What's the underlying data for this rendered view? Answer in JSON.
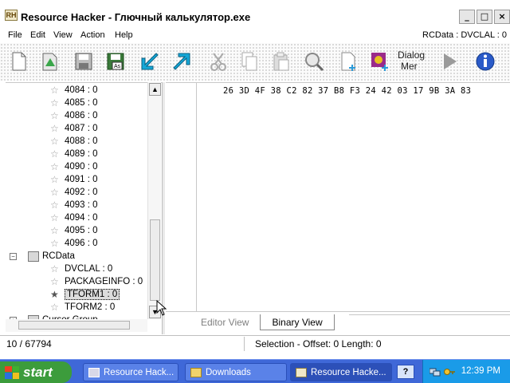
{
  "window": {
    "icon_text": "RH",
    "title": "Resource Hacker - Глючный калькулятор.exe",
    "buttons": {
      "minimize": "_",
      "maximize": "□",
      "close": "×"
    }
  },
  "menu": {
    "items": [
      "File",
      "Edit",
      "View",
      "Action",
      "Help"
    ],
    "resource_path": "RCData : DVCLAL : 0"
  },
  "toolbar": {
    "dialog_label_1": "Dialog",
    "dialog_label_2": "Mer"
  },
  "tree": {
    "numbered": [
      "4084 : 0",
      "4085 : 0",
      "4086 : 0",
      "4087 : 0",
      "4088 : 0",
      "4089 : 0",
      "4090 : 0",
      "4091 : 0",
      "4092 : 0",
      "4093 : 0",
      "4094 : 0",
      "4095 : 0",
      "4096 : 0"
    ],
    "rcdata_label": "RCData",
    "rcdata_items": [
      "DVCLAL : 0",
      "PACKAGEINFO : 0",
      "TFORM1 : 0",
      "TFORM2 : 0"
    ],
    "selected": "TFORM1 : 0",
    "cut_off_item": "Cursor Group"
  },
  "editor": {
    "hex_line": "26 3D 4F 38 C2 82 37 B8 F3 24 42 03 17 9B 3A 83"
  },
  "tabs": {
    "editor_view": "Editor View",
    "binary_view": "Binary View"
  },
  "status": {
    "position": "10 / 67794",
    "selection": "Selection - Offset: 0 Length: 0"
  },
  "taskbar": {
    "start": "start",
    "tasks": [
      "Resource Hack...",
      "Downloads",
      "Resource Hacke..."
    ],
    "help_icon": "?",
    "clock": "12:39 PM"
  }
}
